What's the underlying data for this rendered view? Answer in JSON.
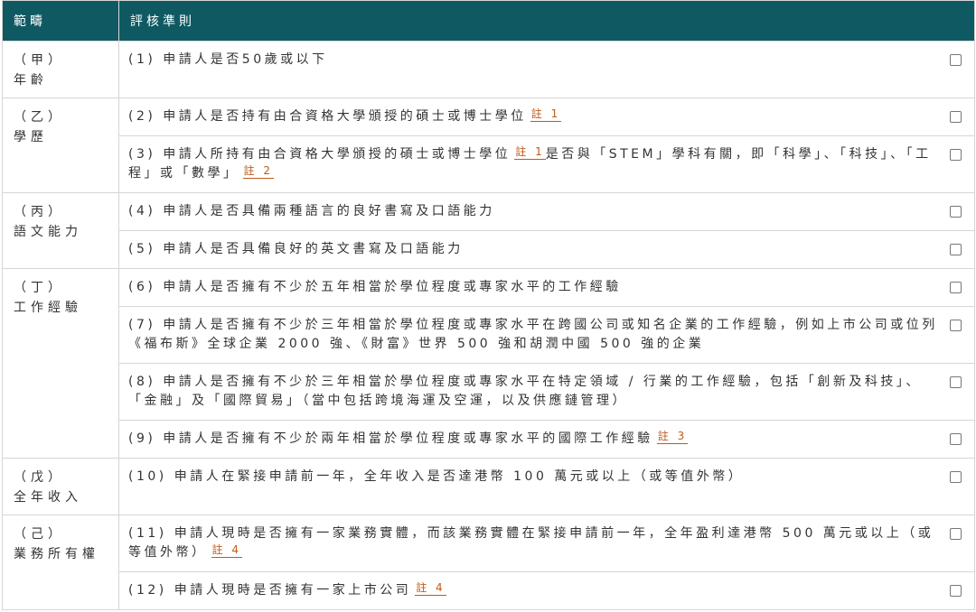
{
  "header": {
    "category": "範疇",
    "criteria": "評核準則"
  },
  "groups": [
    {
      "line1": "（甲）",
      "line2": "年齡",
      "rows": [
        {
          "segments": [
            "(1) 申請人是否50歲或以下"
          ],
          "notes": []
        }
      ]
    },
    {
      "line1": "（乙）",
      "line2": "學歷",
      "rows": [
        {
          "segments": [
            "(2) 申請人是否持有由合資格大學頒授的碩士或博士學位"
          ],
          "notes": [
            "註 1"
          ]
        },
        {
          "segments": [
            "(3) 申請人所持有由合資格大學頒授的碩士或博士學位",
            "是否與「STEM」學科有關，即「科學」、「科技」、「工程」或「數學」"
          ],
          "notes": [
            "註 1",
            "註 2"
          ]
        }
      ]
    },
    {
      "line1": "（丙）",
      "line2": "語文能力",
      "rows": [
        {
          "segments": [
            "(4) 申請人是否具備兩種語言的良好書寫及口語能力"
          ],
          "notes": []
        },
        {
          "segments": [
            "(5) 申請人是否具備良好的英文書寫及口語能力"
          ],
          "notes": []
        }
      ]
    },
    {
      "line1": "（丁）",
      "line2": "工作經驗",
      "rows": [
        {
          "segments": [
            "(6) 申請人是否擁有不少於五年相當於學位程度或專家水平的工作經驗"
          ],
          "notes": []
        },
        {
          "segments": [
            "(7) 申請人是否擁有不少於三年相當於學位程度或專家水平在跨國公司或知名企業的工作經驗，例如上市公司或位列《福布斯》全球企業 2000 強、《財富》世界 500 強和胡潤中國 500 強的企業"
          ],
          "notes": []
        },
        {
          "segments": [
            "(8) 申請人是否擁有不少於三年相當於學位程度或專家水平在特定領域 / 行業的工作經驗，包括「創新及科技」、「金融」及「國際貿易」（當中包括跨境海運及空運，以及供應鏈管理）"
          ],
          "notes": []
        },
        {
          "segments": [
            "(9) 申請人是否擁有不少於兩年相當於學位程度或專家水平的國際工作經驗"
          ],
          "notes": [
            "註 3"
          ]
        }
      ]
    },
    {
      "line1": "（戊）",
      "line2": "全年收入",
      "rows": [
        {
          "segments": [
            "(10) 申請人在緊接申請前一年，全年收入是否達港幣 100 萬元或以上（或等值外幣）"
          ],
          "notes": []
        }
      ]
    },
    {
      "line1": "（己）",
      "line2": "業務所有權",
      "rows": [
        {
          "segments": [
            "(11) 申請人現時是否擁有一家業務實體，而該業務實體在緊接申請前一年，全年盈利達港幣 500 萬元或以上（或等值外幣）"
          ],
          "notes": [
            "註 4"
          ]
        },
        {
          "segments": [
            "(12) 申請人現時是否擁有一家上市公司"
          ],
          "notes": [
            "註 4"
          ]
        }
      ]
    }
  ]
}
